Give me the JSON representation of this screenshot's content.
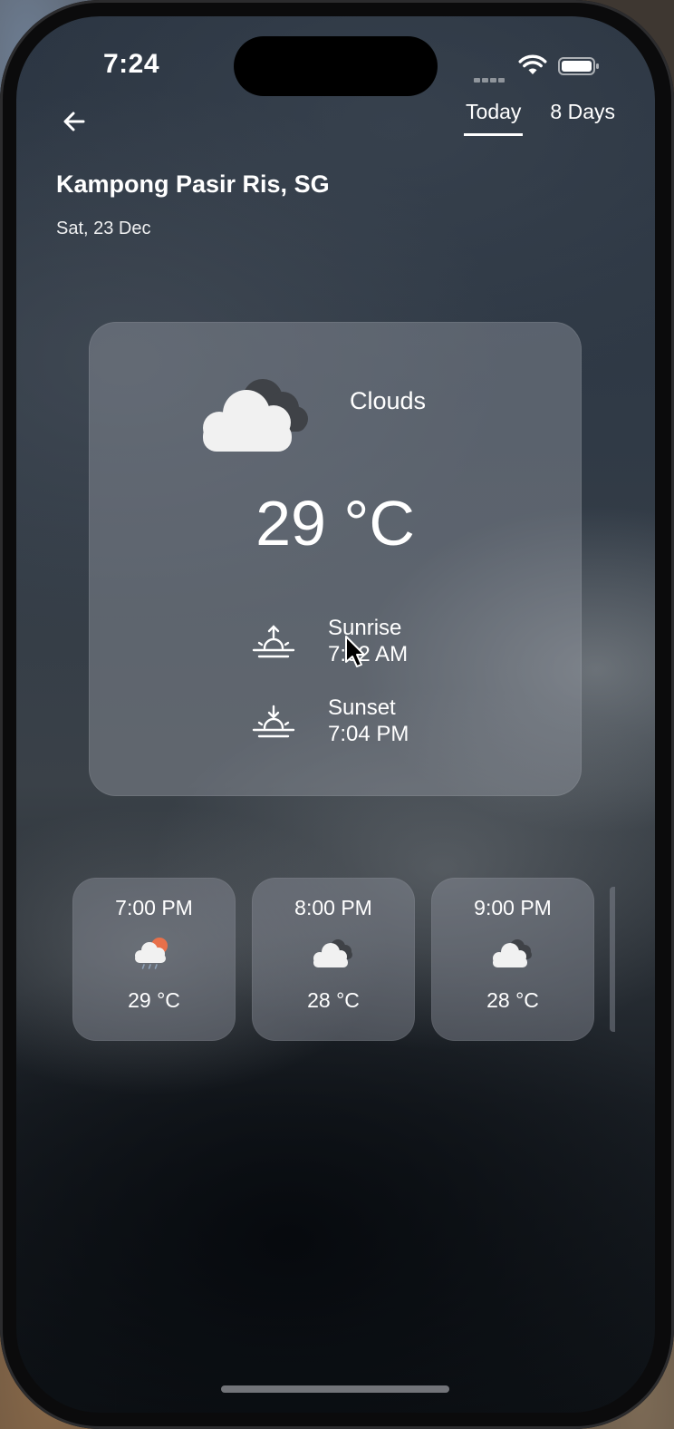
{
  "status_bar": {
    "time": "7:24"
  },
  "header": {
    "back_icon": "arrow-left-icon",
    "tabs": [
      {
        "label": "Today",
        "active": true
      },
      {
        "label": "8 Days",
        "active": false
      }
    ],
    "location": "Kampong Pasir Ris, SG",
    "date": "Sat, 23 Dec"
  },
  "current": {
    "icon": "cloud-icon",
    "condition": "Clouds",
    "temperature": "29 °C",
    "sunrise": {
      "label": "Sunrise",
      "time": "7:02 AM",
      "icon": "sunrise-icon"
    },
    "sunset": {
      "label": "Sunset",
      "time": "7:04 PM",
      "icon": "sunset-icon"
    }
  },
  "hourly": [
    {
      "time": "7:00 PM",
      "icon": "rain-sun-cloud-icon",
      "temp": "29 °C"
    },
    {
      "time": "8:00 PM",
      "icon": "cloud-icon",
      "temp": "28 °C"
    },
    {
      "time": "9:00 PM",
      "icon": "cloud-icon",
      "temp": "28 °C"
    }
  ],
  "colors": {
    "text": "#ffffff",
    "card": "#969ba5",
    "sun_accent": "#e8704a"
  }
}
